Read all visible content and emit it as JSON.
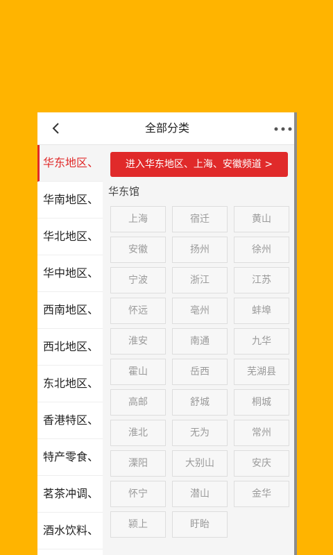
{
  "header": {
    "title": "全部分类"
  },
  "sidebar": {
    "items": [
      {
        "label": "华东地区、"
      },
      {
        "label": "华南地区、"
      },
      {
        "label": "华北地区、"
      },
      {
        "label": "华中地区、"
      },
      {
        "label": "西南地区、"
      },
      {
        "label": "西北地区、"
      },
      {
        "label": "东北地区、"
      },
      {
        "label": "香港特区、"
      },
      {
        "label": "特产零食、"
      },
      {
        "label": "茗茶冲调、"
      },
      {
        "label": "酒水饮料、"
      }
    ],
    "active_index": 0
  },
  "main": {
    "enter_button": "进入华东地区、上海、安徽频道 >",
    "section_title": "华东馆",
    "cities": [
      "上海",
      "宿迁",
      "黄山",
      "安徽",
      "扬州",
      "徐州",
      "宁波",
      "浙江",
      "江苏",
      "怀远",
      "亳州",
      "蚌埠",
      "淮安",
      "南通",
      "九华",
      "霍山",
      "岳西",
      "芜湖县",
      "高邮",
      "舒城",
      "桐城",
      "淮北",
      "无为",
      "常州",
      "溧阳",
      "大别山",
      "安庆",
      "怀宁",
      "潜山",
      "金华",
      "颍上",
      "盱眙"
    ]
  },
  "colors": {
    "background": "#FFB400",
    "accent": "#E02A2A"
  }
}
